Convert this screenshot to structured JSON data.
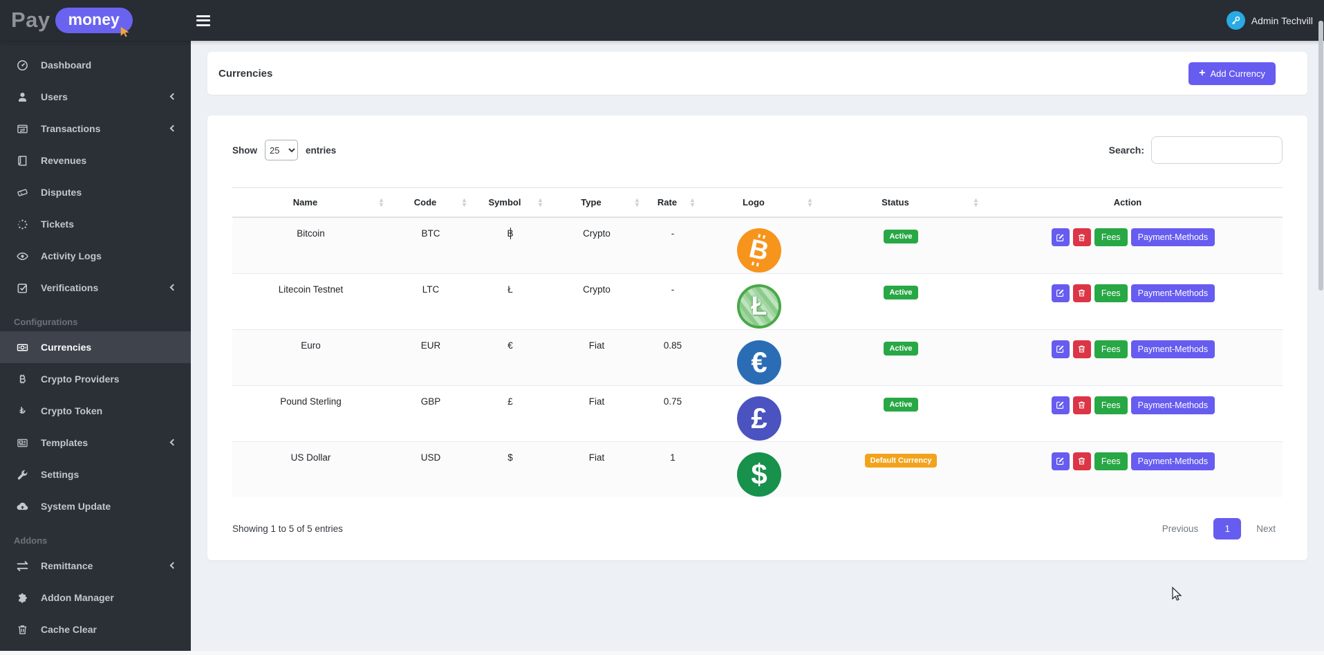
{
  "brand": {
    "text_primary": "Pay",
    "text_pill": "money"
  },
  "topbar": {
    "user_name": "Admin Techvill"
  },
  "sidebar": {
    "items": [
      {
        "label": "Dashboard",
        "icon": "dashboard"
      },
      {
        "label": "Users",
        "icon": "users",
        "chevron": true
      },
      {
        "label": "Transactions",
        "icon": "transactions",
        "chevron": true
      },
      {
        "label": "Revenues",
        "icon": "revenues"
      },
      {
        "label": "Disputes",
        "icon": "disputes"
      },
      {
        "label": "Tickets",
        "icon": "tickets"
      },
      {
        "label": "Activity Logs",
        "icon": "activity-logs"
      },
      {
        "label": "Verifications",
        "icon": "verifications",
        "chevron": true
      },
      {
        "type": "section",
        "label": "Configurations"
      },
      {
        "label": "Currencies",
        "icon": "currencies",
        "active": true
      },
      {
        "label": "Crypto Providers",
        "icon": "crypto-providers"
      },
      {
        "label": "Crypto Token",
        "icon": "crypto-token"
      },
      {
        "label": "Templates",
        "icon": "templates",
        "chevron": true
      },
      {
        "label": "Settings",
        "icon": "settings"
      },
      {
        "label": "System Update",
        "icon": "system-update"
      },
      {
        "type": "section",
        "label": "Addons"
      },
      {
        "label": "Remittance",
        "icon": "remittance",
        "chevron": true
      },
      {
        "label": "Addon Manager",
        "icon": "addon-manager"
      },
      {
        "label": "Cache Clear",
        "icon": "cache-clear"
      }
    ]
  },
  "page": {
    "title": "Currencies",
    "add_button": {
      "label": "Add Currency",
      "icon": "plus-icon"
    }
  },
  "table_controls": {
    "show_label": "Show",
    "page_size": "25",
    "entries_label": "entries",
    "search_label": "Search:",
    "search_value": ""
  },
  "table": {
    "columns": [
      {
        "label": "Name",
        "sortable": true
      },
      {
        "label": "Code",
        "sortable": true
      },
      {
        "label": "Symbol",
        "sortable": true
      },
      {
        "label": "Type",
        "sortable": true
      },
      {
        "label": "Rate",
        "sortable": true
      },
      {
        "label": "Logo",
        "sortable": true
      },
      {
        "label": "Status",
        "sortable": true
      },
      {
        "label": "Action",
        "sortable": false
      }
    ],
    "rows": [
      {
        "name": "Bitcoin",
        "code": "BTC",
        "symbol": "฿",
        "type": "Crypto",
        "rate": "-",
        "logo": "bitcoin",
        "logo_color": "#f7941c",
        "status": "Active",
        "status_type": "active"
      },
      {
        "name": "Litecoin Testnet",
        "code": "LTC",
        "symbol": "Ł",
        "type": "Crypto",
        "rate": "-",
        "logo": "litecoin",
        "logo_color": "#49a948",
        "status": "Active",
        "status_type": "active"
      },
      {
        "name": "Euro",
        "code": "EUR",
        "symbol": "€",
        "type": "Fiat",
        "rate": "0.85",
        "logo": "euro",
        "logo_color": "#2a6db5",
        "status": "Active",
        "status_type": "active"
      },
      {
        "name": "Pound Sterling",
        "code": "GBP",
        "symbol": "£",
        "type": "Fiat",
        "rate": "0.75",
        "logo": "pound",
        "logo_color": "#4a53c0",
        "status": "Active",
        "status_type": "active"
      },
      {
        "name": "US Dollar",
        "code": "USD",
        "symbol": "$",
        "type": "Fiat",
        "rate": "1",
        "logo": "dollar",
        "logo_color": "#17914b",
        "status": "Default Currency",
        "status_type": "default"
      }
    ],
    "action_labels": {
      "fees": "Fees",
      "payment_methods": "Payment-Methods"
    }
  },
  "footer": {
    "showing_text": "Showing 1 to 5 of 5 entries",
    "pagination": {
      "previous": "Previous",
      "current_page": "1",
      "next": "Next"
    }
  },
  "colors": {
    "accent": "#665cf0",
    "success": "#28a745",
    "danger": "#dc3545",
    "warning": "#f2a31c",
    "sidebar_bg": "#2b2f36",
    "sidebar_active_bg": "#3e434c",
    "content_bg": "#edf0f5",
    "avatar_bg": "#29aae3"
  }
}
